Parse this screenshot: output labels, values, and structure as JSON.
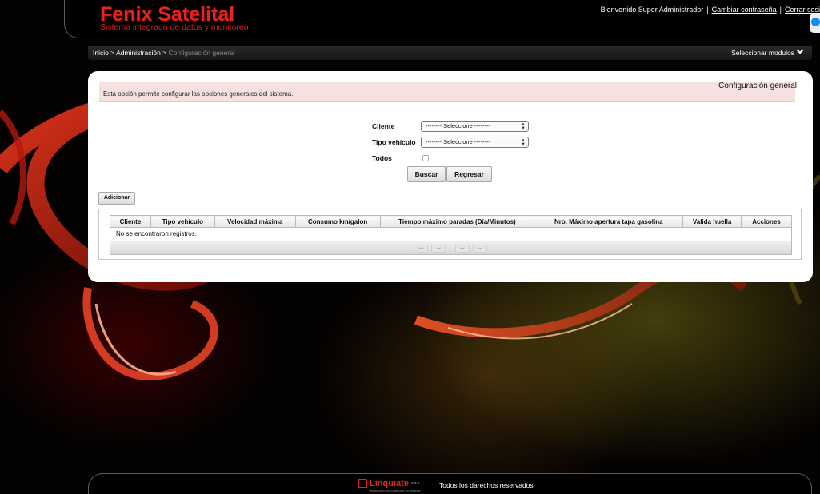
{
  "header": {
    "logo_title": "Fenix Satelital",
    "logo_subtitle": "Sistema integrado de datos y monitoreo",
    "welcome": "Bienvenido Super Administrador",
    "change_password": "Cambiar contraseña",
    "logout": "Cerrar sesi"
  },
  "breadcrumb": {
    "home": "Inicio",
    "separator": ">",
    "admin": "Administración",
    "current": "Configuración general",
    "modules_label": "Seleccionar modulos"
  },
  "page": {
    "title": "Configuración general",
    "notice": "Esta opción permite configurar las opciones generales del sistema."
  },
  "form": {
    "client_label": "Cliente",
    "client_value": "-------- Seleccione --------",
    "vehicle_type_label": "Tipo vehículo",
    "vehicle_type_value": "-------- Seleccione --------",
    "all_label": "Todos",
    "all_checked": false,
    "search_button": "Buscar",
    "back_button": "Regresar"
  },
  "add_button": "Adicionar",
  "table": {
    "columns": [
      "Cliente",
      "Tipo vehículo",
      "Velocidad máxima",
      "Consumo km/galon",
      "Tiempo máximo paradas (Día/Minutos)",
      "Nro. Máximo apertura tapa gasolina",
      "Valida huella",
      "Acciones"
    ],
    "empty_message": "No se encontraron registros."
  },
  "pager": {
    "first": "|◂◂",
    "prev": "◂◂",
    "next": "▸▸",
    "last": "▸▸|"
  },
  "footer": {
    "brand": "Linquiate",
    "brand_suffix": "s.a.s",
    "brand_tagline": "Integración tecnológica a su alcance",
    "rights": "Todos los darechos reservados"
  },
  "colors": {
    "brand_red": "#e3261c",
    "notice_bg": "#f6e1e1"
  }
}
